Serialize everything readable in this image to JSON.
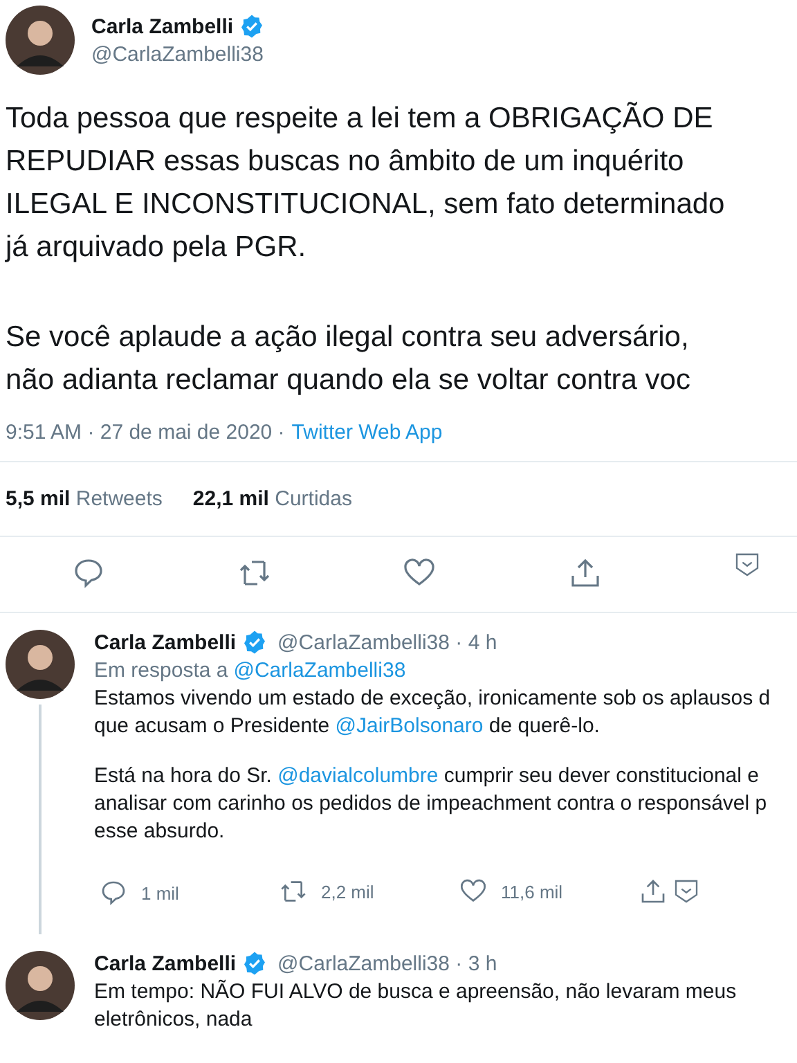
{
  "tweet": {
    "author": {
      "name": "Carla Zambelli",
      "verified": true,
      "handle": "@CarlaZambelli38"
    },
    "paragraphs": [
      [
        "Toda pessoa que respeite a lei tem a OBRIGAÇÃO DE",
        "REPUDIAR essas buscas no âmbito de um inquérito",
        "ILEGAL E INCONSTITUCIONAL, sem fato determinado",
        "já arquivado pela PGR."
      ],
      [
        "Se você aplaude a ação ilegal contra seu adversário,",
        "não adianta reclamar quando ela se voltar contra voc"
      ]
    ],
    "timestamp": "9:51 AM · 27 de mai de 2020 ·",
    "source": "Twitter Web App",
    "stats": [
      {
        "count": "5,5 mil",
        "label": "Retweets"
      },
      {
        "count": "22,1 mil",
        "label": "Curtidas"
      }
    ],
    "actions": [
      {
        "kind": "reply"
      },
      {
        "kind": "retweet"
      },
      {
        "kind": "like"
      },
      {
        "kind": "share"
      },
      {
        "kind": "more"
      }
    ]
  },
  "replies": [
    {
      "name": "Carla Zambelli",
      "verified": true,
      "meta": "@CarlaZambelli38 · 4 h",
      "reply_to": {
        "prefix": "Em resposta a",
        "mention": "@CarlaZambelli38"
      },
      "thread_line": true,
      "paragraphs": [
        [
          [
            {
              "kind": "text",
              "text": "Estamos vivendo um estado de exceção, ironicamente sob os aplausos d"
            }
          ],
          [
            {
              "kind": "text",
              "text": "que acusam o Presidente "
            },
            {
              "kind": "mention",
              "text": "@JairBolsonaro"
            },
            {
              "kind": "text",
              "text": " de querê-lo."
            }
          ]
        ],
        [
          [
            {
              "kind": "text",
              "text": "Está na hora do Sr. "
            },
            {
              "kind": "mention",
              "text": "@davialcolumbre"
            },
            {
              "kind": "text",
              "text": " cumprir seu dever constitucional e"
            }
          ],
          [
            {
              "kind": "text",
              "text": "analisar com carinho os pedidos de impeachment contra o responsável p"
            }
          ],
          [
            {
              "kind": "text",
              "text": "esse absurdo."
            }
          ]
        ]
      ],
      "actions": [
        {
          "kind": "reply",
          "count": "1 mil"
        },
        {
          "kind": "retweet",
          "count": "2,2 mil"
        },
        {
          "kind": "like",
          "count": "11,6 mil"
        },
        {
          "kind": "share"
        },
        {
          "kind": "more"
        }
      ]
    },
    {
      "name": "Carla Zambelli",
      "verified": true,
      "meta": "@CarlaZambelli38 · 3 h",
      "thread_line": false,
      "paragraphs": [
        [
          [
            {
              "kind": "text",
              "text": "Em tempo: NÃO FUI ALVO de busca e apreensão, não levaram meus"
            }
          ],
          [
            {
              "kind": "text",
              "text": "eletrônicos, nada"
            }
          ]
        ]
      ]
    }
  ]
}
